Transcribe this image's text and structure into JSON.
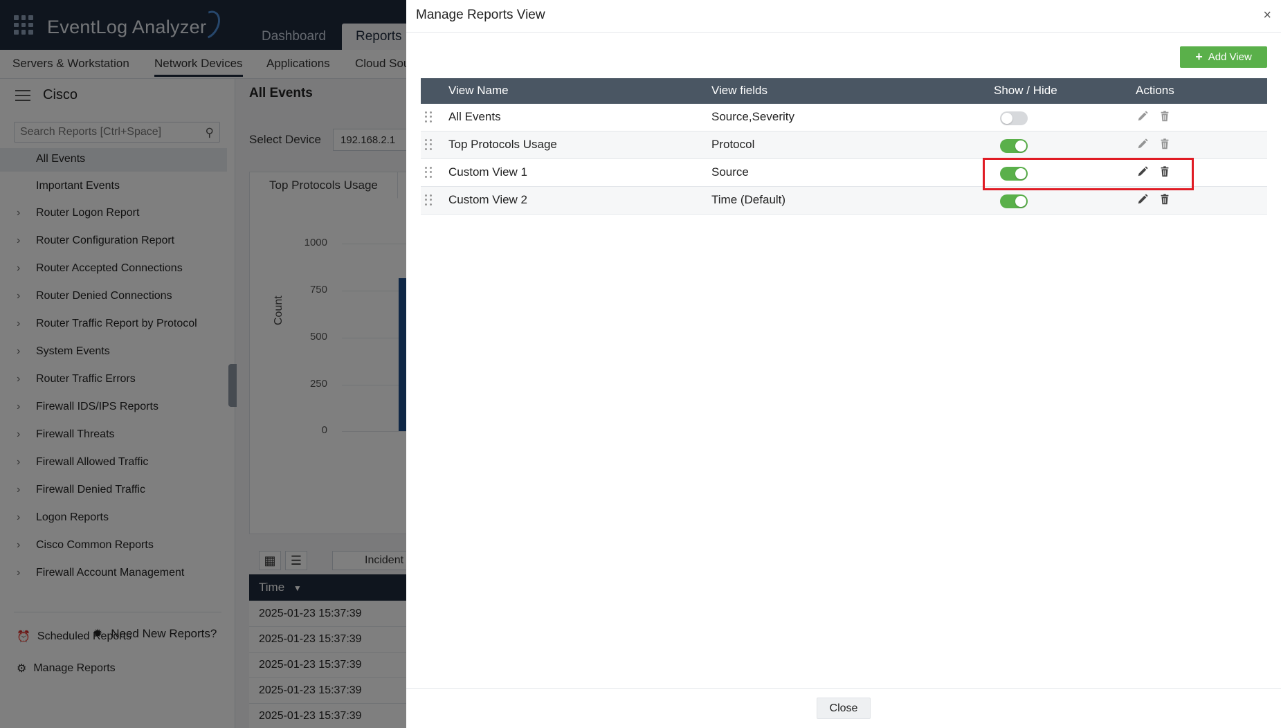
{
  "app": {
    "logo": "EventLog Analyzer",
    "top_tabs": [
      {
        "label": "Dashboard"
      },
      {
        "label": "Reports"
      }
    ],
    "sub_nav": [
      {
        "label": "Servers & Workstation"
      },
      {
        "label": "Network Devices"
      },
      {
        "label": "Applications"
      },
      {
        "label": "Cloud Sou"
      }
    ]
  },
  "sidebar": {
    "title": "Cisco",
    "search_placeholder": "Search Reports [Ctrl+Space]",
    "plain_items": [
      {
        "label": "All Events",
        "selected": true
      },
      {
        "label": "Important Events",
        "selected": false
      }
    ],
    "groups": [
      {
        "label": "Router Logon Report"
      },
      {
        "label": "Router Configuration Report"
      },
      {
        "label": "Router Accepted Connections"
      },
      {
        "label": "Router Denied Connections"
      },
      {
        "label": "Router Traffic Report by Protocol"
      },
      {
        "label": "System Events"
      },
      {
        "label": "Router Traffic Errors"
      },
      {
        "label": "Firewall IDS/IPS Reports"
      },
      {
        "label": "Firewall Threats"
      },
      {
        "label": "Firewall Allowed Traffic"
      },
      {
        "label": "Firewall Denied Traffic"
      },
      {
        "label": "Logon Reports"
      },
      {
        "label": "Cisco Common Reports"
      },
      {
        "label": "Firewall Account Management"
      }
    ],
    "footer": {
      "scheduled": "Scheduled Reports",
      "manage": "Manage Reports",
      "need_new": "Need New Reports?"
    }
  },
  "content": {
    "title": "All Events",
    "select_label": "Select Device",
    "select_value": "192.168.2.1",
    "chart_tab": "Top Protocols Usage",
    "ylabel": "Count",
    "yticks": [
      "1000",
      "750",
      "500",
      "250",
      "0"
    ],
    "incident_label": "Incident",
    "time_header": "Time",
    "time_rows": [
      "2025-01-23 15:37:39",
      "2025-01-23 15:37:39",
      "2025-01-23 15:37:39",
      "2025-01-23 15:37:39",
      "2025-01-23 15:37:39"
    ]
  },
  "modal": {
    "title": "Manage Reports View",
    "close_symbol": "×",
    "add_view_label": "Add View",
    "columns": {
      "name": "View Name",
      "fields": "View fields",
      "show_hide": "Show / Hide",
      "actions": "Actions"
    },
    "rows": [
      {
        "name": "All Events",
        "fields": "Source,Severity",
        "visible": false,
        "editable": false
      },
      {
        "name": "Top Protocols Usage",
        "fields": "Protocol",
        "visible": true,
        "editable": false
      },
      {
        "name": "Custom View 1",
        "fields": "Source",
        "visible": true,
        "editable": true
      },
      {
        "name": "Custom View 2",
        "fields": "Time (Default)",
        "visible": true,
        "editable": true
      }
    ],
    "close_button": "Close"
  },
  "colors": {
    "accent_green": "#5ab04a",
    "header_gray": "#4a5663",
    "highlight_red": "#e01b24",
    "nav_dark": "#1e2a3d"
  },
  "icons": {
    "drag": "drag-handle-icon",
    "edit": "pencil-icon",
    "delete": "trash-icon",
    "add": "plus-icon",
    "close": "close-icon"
  }
}
